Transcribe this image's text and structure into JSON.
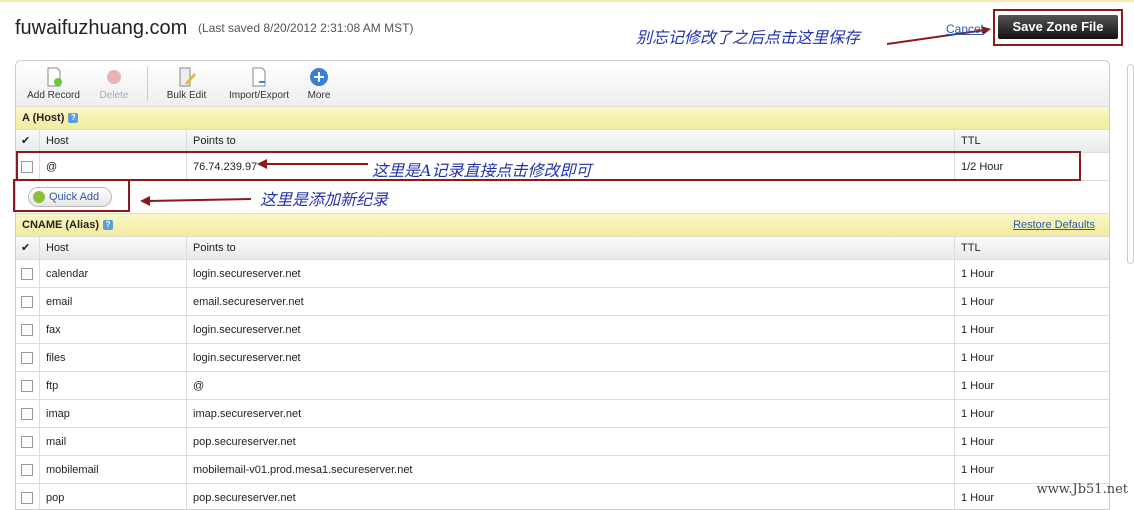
{
  "header": {
    "domain": "fuwaifuzhuang.com",
    "last_saved": "(Last saved 8/20/2012 2:31:08 AM MST)",
    "cancel": "Cancel",
    "save": "Save Zone File"
  },
  "annotations": {
    "save_note": "别忘记修改了之后点击这里保存",
    "a_record_note": "这里是A记录直接点击修改即可",
    "quick_add_note": "这里是添加新纪录"
  },
  "toolbar": [
    {
      "label": "Add Record",
      "icon": "add-record-icon"
    },
    {
      "label": "Delete",
      "icon": "delete-icon"
    },
    {
      "label": "Bulk Edit",
      "icon": "bulk-edit-icon"
    },
    {
      "label": "Import/Export",
      "icon": "import-export-icon"
    },
    {
      "label": "More",
      "icon": "more-icon"
    }
  ],
  "a_section": {
    "title": "A (Host)",
    "columns": [
      "Host",
      "Points to",
      "TTL"
    ],
    "rows": [
      {
        "host": "@",
        "points": "76.74.239.97",
        "ttl": "1/2 Hour"
      }
    ],
    "quick_add": "Quick Add"
  },
  "cname_section": {
    "title": "CNAME (Alias)",
    "restore": "Restore Defaults",
    "columns": [
      "Host",
      "Points to",
      "TTL"
    ],
    "rows": [
      {
        "host": "calendar",
        "points": "login.secureserver.net",
        "ttl": "1 Hour"
      },
      {
        "host": "email",
        "points": "email.secureserver.net",
        "ttl": "1 Hour"
      },
      {
        "host": "fax",
        "points": "login.secureserver.net",
        "ttl": "1 Hour"
      },
      {
        "host": "files",
        "points": "login.secureserver.net",
        "ttl": "1 Hour"
      },
      {
        "host": "ftp",
        "points": "@",
        "ttl": "1 Hour"
      },
      {
        "host": "imap",
        "points": "imap.secureserver.net",
        "ttl": "1 Hour"
      },
      {
        "host": "mail",
        "points": "pop.secureserver.net",
        "ttl": "1 Hour"
      },
      {
        "host": "mobilemail",
        "points": "mobilemail-v01.prod.mesa1.secureserver.net",
        "ttl": "1 Hour"
      },
      {
        "host": "pop",
        "points": "pop.secureserver.net",
        "ttl": "1 Hour"
      }
    ]
  },
  "watermark": "www.Jb51.net",
  "colors": {
    "annotation": "#2233aa",
    "highlight_box": "#8b1a1a",
    "section_bg": "#f5f1b5",
    "link": "#2a5aa8"
  }
}
